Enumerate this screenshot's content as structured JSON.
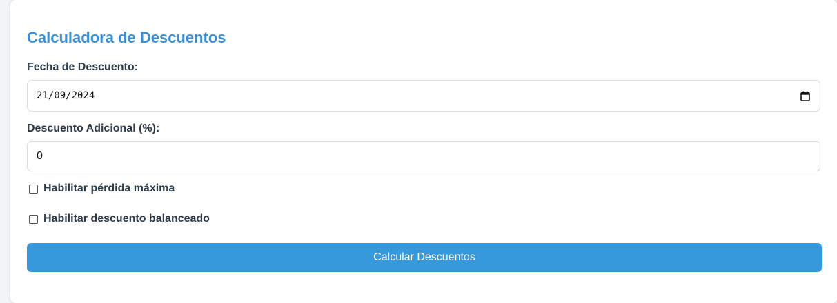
{
  "form": {
    "title": "Calculadora de Descuentos",
    "date_label": "Fecha de Descuento:",
    "date_value": "21/09/2024",
    "discount_label": "Descuento Adicional (%):",
    "discount_value": "0",
    "max_loss_label": "Habilitar pérdida máxima",
    "max_loss_checked": false,
    "balanced_label": "Habilitar descuento balanceado",
    "balanced_checked": false,
    "calculate_button": "Calcular Descuentos"
  },
  "colors": {
    "title": "#3a8fd6",
    "button": "#3699dc",
    "label": "#2d3a4a"
  }
}
